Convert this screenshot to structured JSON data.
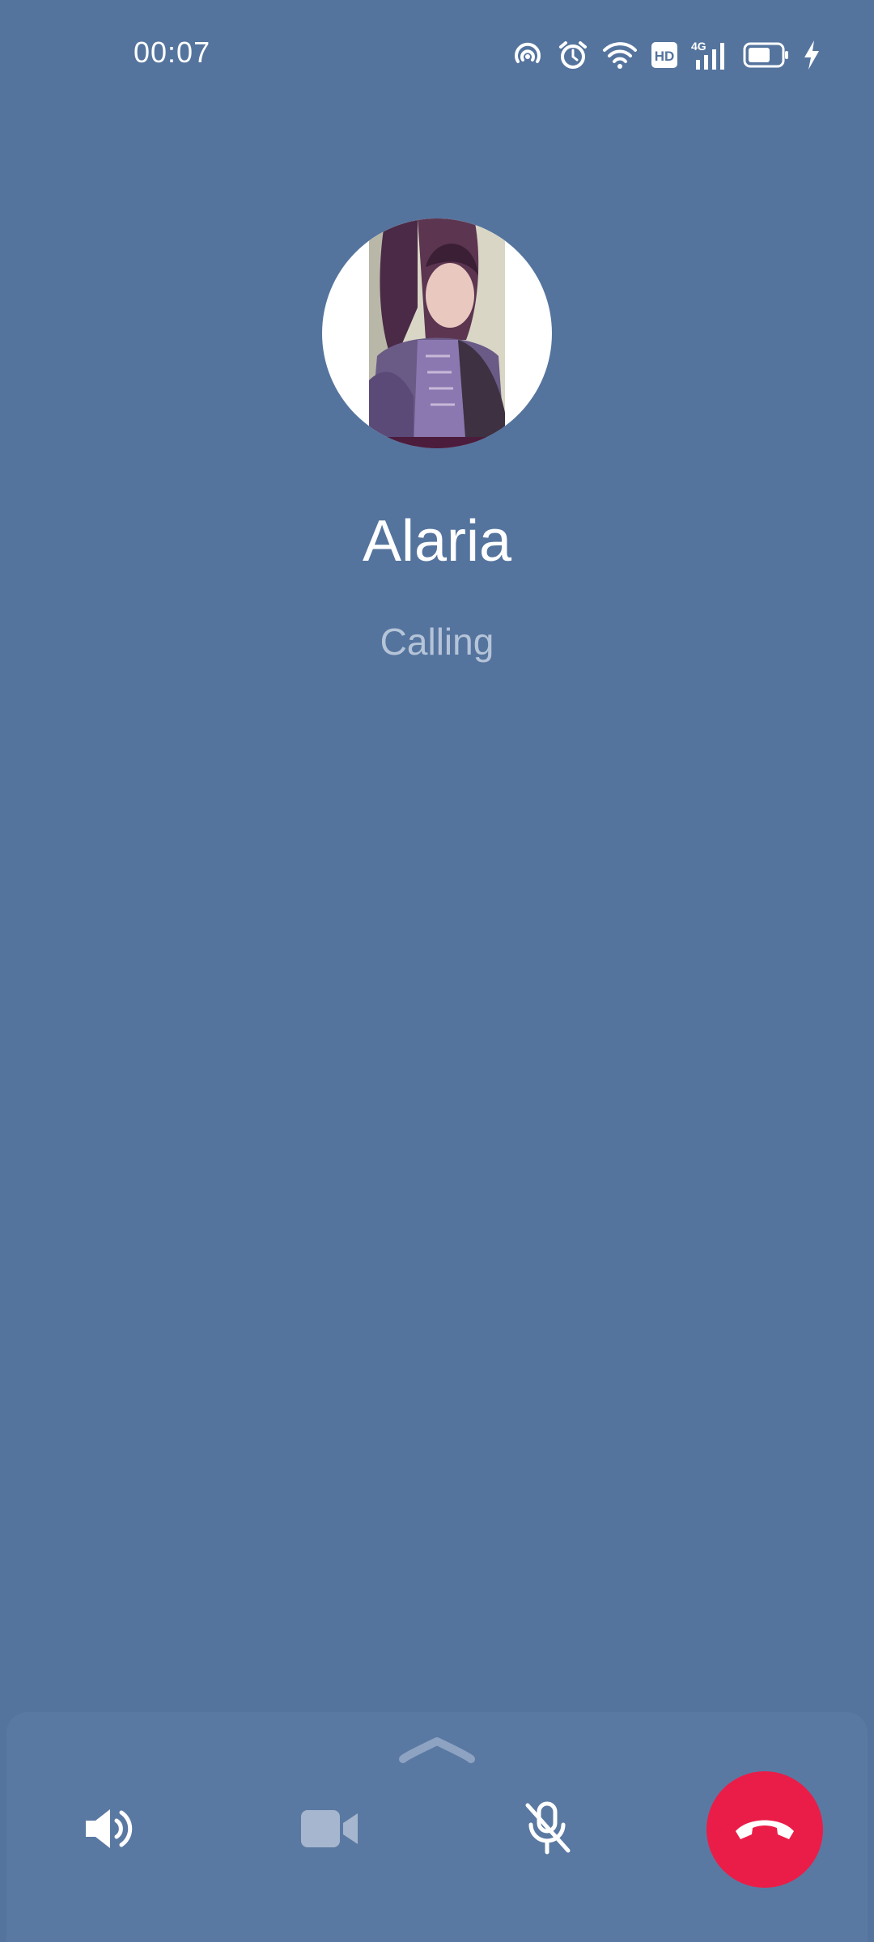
{
  "status_bar": {
    "time": "00:07",
    "icons": [
      "hotspot-icon",
      "alarm-icon",
      "wifi-icon",
      "hd-icon",
      "signal-4g-icon",
      "battery-icon",
      "charging-icon"
    ],
    "network_label": "4G",
    "hd_label": "HD"
  },
  "call": {
    "caller_name": "Alaria",
    "status": "Calling"
  },
  "controls": {
    "items": [
      "speaker-icon",
      "video-icon",
      "mute-icon",
      "end-call-icon"
    ]
  },
  "colors": {
    "background": "#54749e",
    "end_call": "#ea1d48",
    "status_text": "#b6c4d8"
  }
}
